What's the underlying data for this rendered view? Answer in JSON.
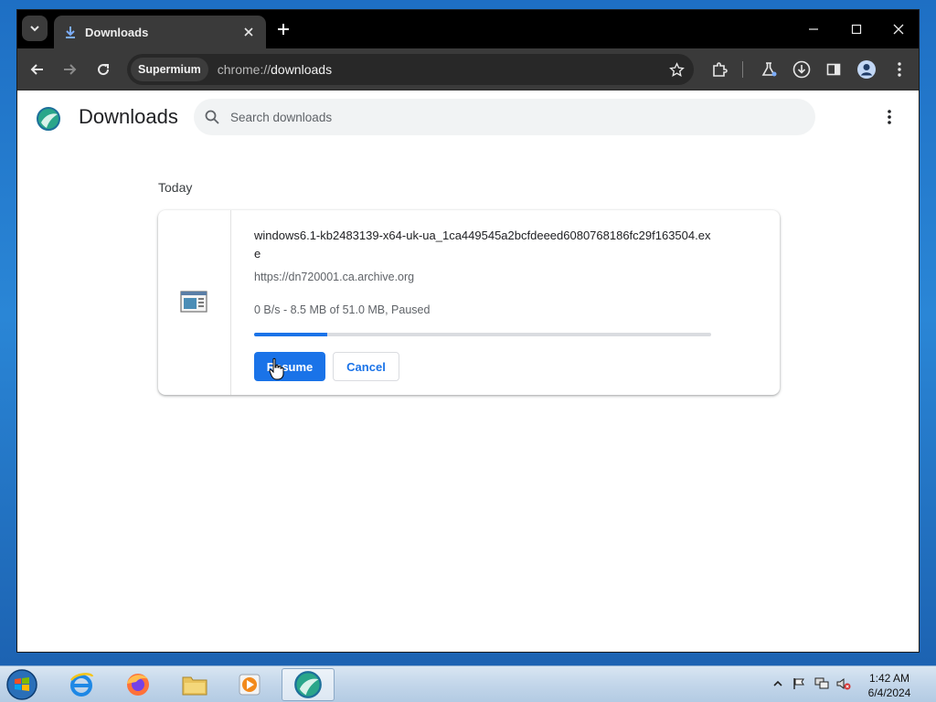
{
  "browser": {
    "tab": {
      "title": "Downloads"
    },
    "omnibox": {
      "site_chip": "Supermium",
      "url_scheme": "chrome://",
      "url_path": "downloads"
    }
  },
  "page": {
    "title": "Downloads",
    "search_placeholder": "Search downloads"
  },
  "downloads": {
    "date_group": "Today",
    "items": [
      {
        "file_name": "windows6.1-kb2483139-x64-uk-ua_1ca449545a2bcfdeeed6080768186fc29f163504.exe",
        "source_url": "https://dn720001.ca.archive.org",
        "status": "0 B/s - 8.5 MB of 51.0 MB, Paused",
        "progress_fraction": 0.16,
        "resume_label": "Resume",
        "cancel_label": "Cancel"
      }
    ]
  },
  "taskbar": {
    "apps": [
      "internet-explorer-icon",
      "firefox-icon",
      "file-explorer-icon",
      "media-player-icon",
      "supermium-icon"
    ],
    "clock": {
      "time": "1:42 AM",
      "date": "6/4/2024"
    }
  },
  "colors": {
    "accent": "#1a73e8",
    "titlebar": "#000000",
    "toolbar": "#3a3a3a"
  }
}
